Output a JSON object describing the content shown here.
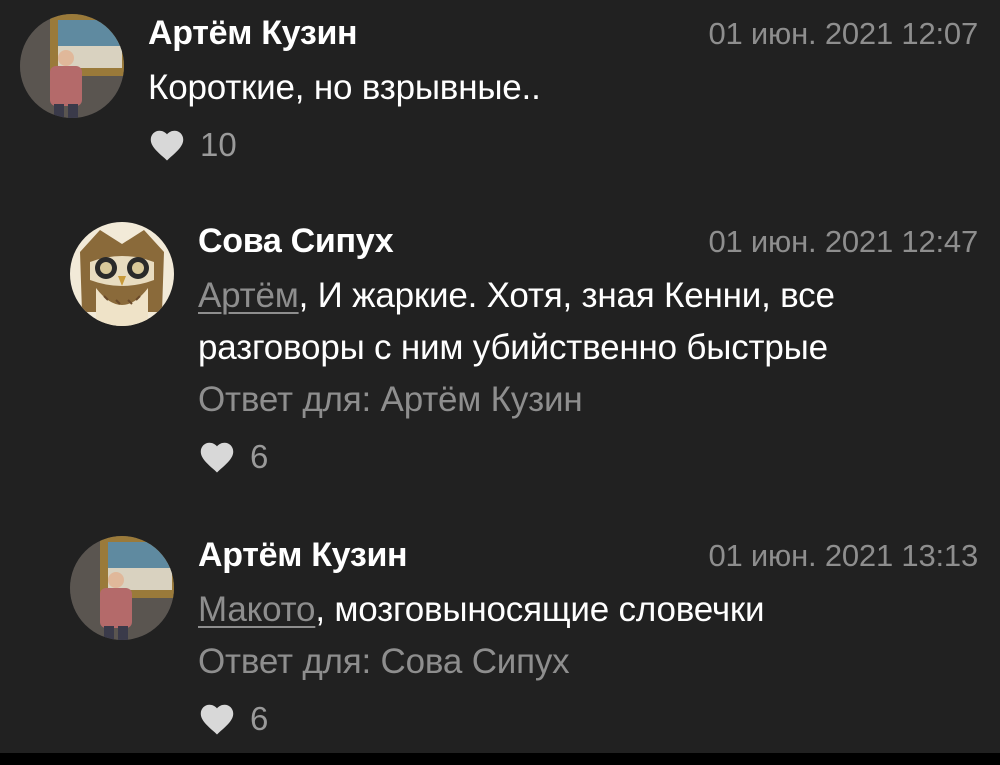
{
  "comments": [
    {
      "author": "Артём Кузин",
      "date": "01 июн. 2021 12:07",
      "mention": "",
      "text": "Короткие, но взрывные..",
      "reply_to": "",
      "likes": "10",
      "avatar": "photo-avatar"
    },
    {
      "author": "Сова Сипух",
      "date": "01 июн. 2021 12:47",
      "mention": "Артём",
      "text": ", И жаркие. Хотя, зная Кенни, все разговоры с ним убийственно быстрые",
      "reply_to": "Ответ для: Артём Кузин",
      "likes": "6",
      "avatar": "owl-avatar"
    },
    {
      "author": "Артём Кузин",
      "date": "01 июн. 2021 13:13",
      "mention": "Макото",
      "text": ", мозговыносящие словечки",
      "reply_to": "Ответ для: Сова Сипух",
      "likes": "6",
      "avatar": "photo-avatar"
    }
  ],
  "icons": {
    "like": "heart-icon"
  },
  "colors": {
    "background": "#212121",
    "text": "#ffffff",
    "muted": "#8e8e8e"
  }
}
